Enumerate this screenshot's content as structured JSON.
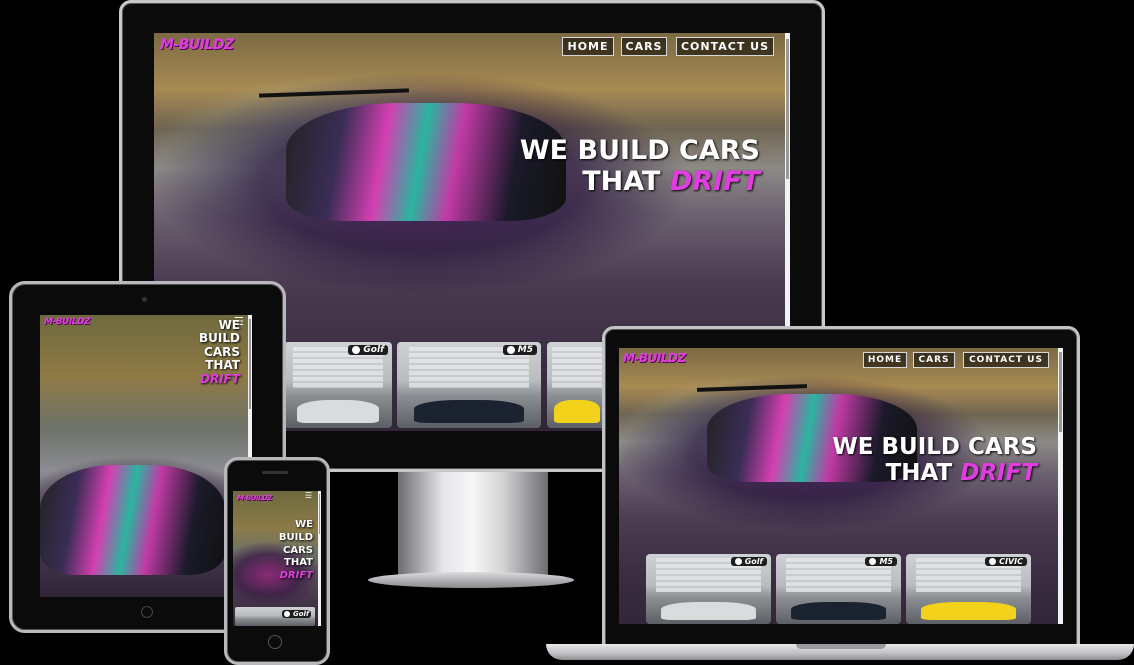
{
  "brand": {
    "logo_text": "M-BUILDZ"
  },
  "nav": {
    "home": "HOME",
    "cars": "CARS",
    "contact": "CONTACT US",
    "menu_icon": "hamburger-menu-icon"
  },
  "hero": {
    "line1": "WE BUILD CARS",
    "line2_prefix": "THAT",
    "accent": "DRIFT",
    "stack_we": "WE",
    "stack_build": "BUILD",
    "stack_cars": "CARS",
    "stack_that": "THAT"
  },
  "cards": [
    {
      "badge": "Golf",
      "icon": "vw-logo-icon",
      "car_color": "#d9dadb"
    },
    {
      "badge": "M5",
      "icon": "bmw-logo-icon",
      "car_color": "#1c2330"
    },
    {
      "badge": "CIVIC",
      "icon": "honda-logo-icon",
      "car_color": "#f2d21b"
    }
  ],
  "colors": {
    "accent": "#e23de0",
    "background": "#000000",
    "bezel": "#0b0b0b"
  }
}
